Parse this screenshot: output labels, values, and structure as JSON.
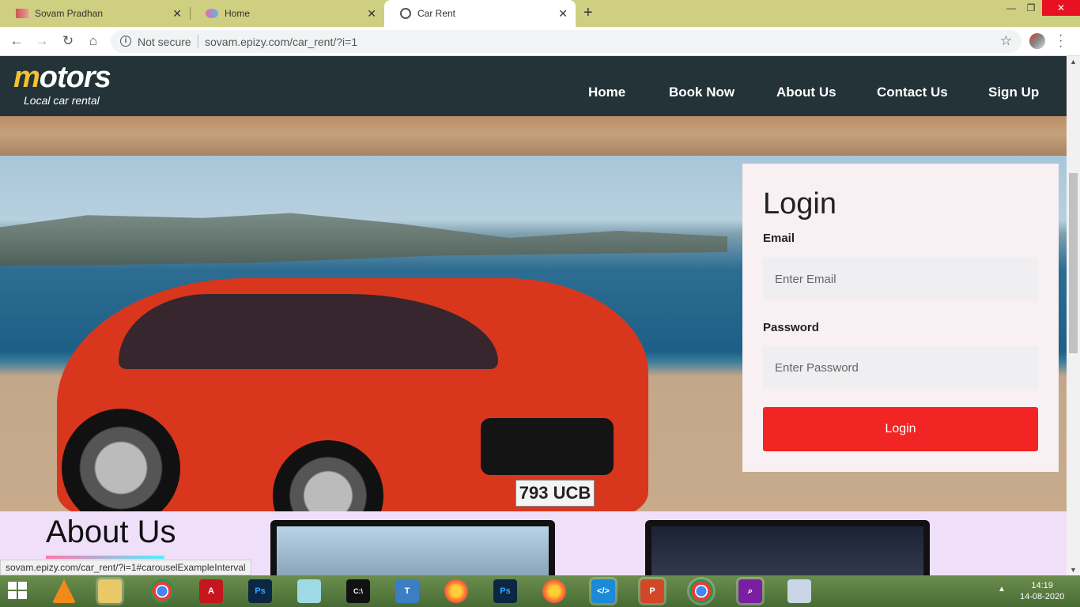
{
  "browser": {
    "tabs": [
      {
        "title": "Sovam Pradhan",
        "active": false
      },
      {
        "title": "Home",
        "active": false
      },
      {
        "title": "Car Rent",
        "active": true
      }
    ],
    "security_label": "Not secure",
    "url": "sovam.epizy.com/car_rent/?i=1",
    "status_url": "sovam.epizy.com/car_rent/?i=1#carouselExampleInterval"
  },
  "site": {
    "logo_accent": "m",
    "logo_rest": "otors",
    "tagline": "Local car rental",
    "nav": [
      "Home",
      "Book Now",
      "About Us",
      "Contact Us",
      "Sign Up"
    ]
  },
  "hero": {
    "plate": "793 UCB"
  },
  "login": {
    "title": "Login",
    "email_label": "Email",
    "email_placeholder": "Enter Email",
    "password_label": "Password",
    "password_placeholder": "Enter Password",
    "button": "Login"
  },
  "about": {
    "title": "About Us"
  },
  "taskbar": {
    "apps": [
      "vlc-icon",
      "file-explorer-icon",
      "chrome-icon",
      "acrobat-icon",
      "photoshop-icon",
      "notepad-icon",
      "cmd-icon",
      "typing-tutor-icon",
      "firefox-icon",
      "photoshop-icon",
      "firefox-icon",
      "vscode-icon",
      "powerpoint-icon",
      "chrome-icon",
      "search-icon",
      "paint-icon"
    ],
    "time": "14:19",
    "date": "14-08-2020"
  },
  "colors": {
    "tabstrip": "#cfcf82",
    "navbar": "#233338",
    "logo_accent": "#f2c230",
    "login_button": "#f22424",
    "page_bg": "#f0dff8"
  }
}
